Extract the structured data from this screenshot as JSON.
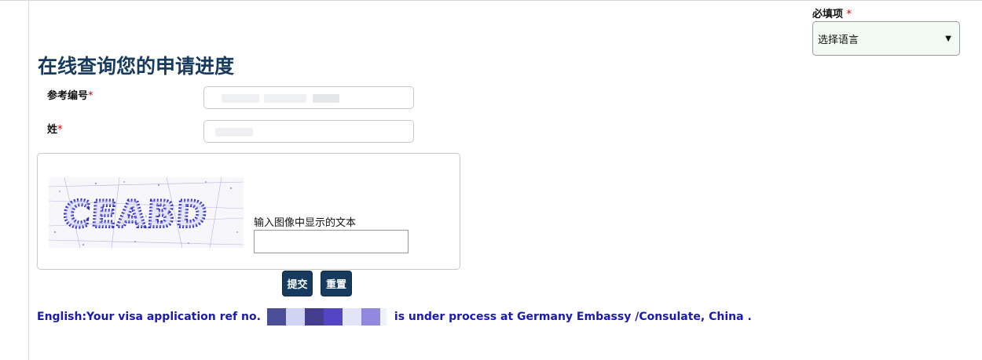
{
  "required_note": {
    "label": "必填项",
    "star": "*"
  },
  "language_select": {
    "selected": "选择语言",
    "caret": "▼"
  },
  "page_title": "在线查询您的申请进度",
  "fields": [
    {
      "label": "参考编号",
      "star": "*"
    },
    {
      "label": "姓",
      "star": "*"
    }
  ],
  "captcha": {
    "image_text": "CEABD",
    "prompt": "输入图像中显示的文本",
    "input_value": ""
  },
  "buttons": {
    "submit": "提交",
    "reset": "重置"
  },
  "status": {
    "prefix": "English:Your visa application ref no.",
    "suffix": "is under process at Germany Embassy /Consulate,  China ."
  },
  "colors": {
    "title": "#173b5e",
    "button_bg": "#173b5e",
    "status_text": "#1a1ab0",
    "required_star": "#cc0000",
    "select_bg": "#f3faf3"
  }
}
